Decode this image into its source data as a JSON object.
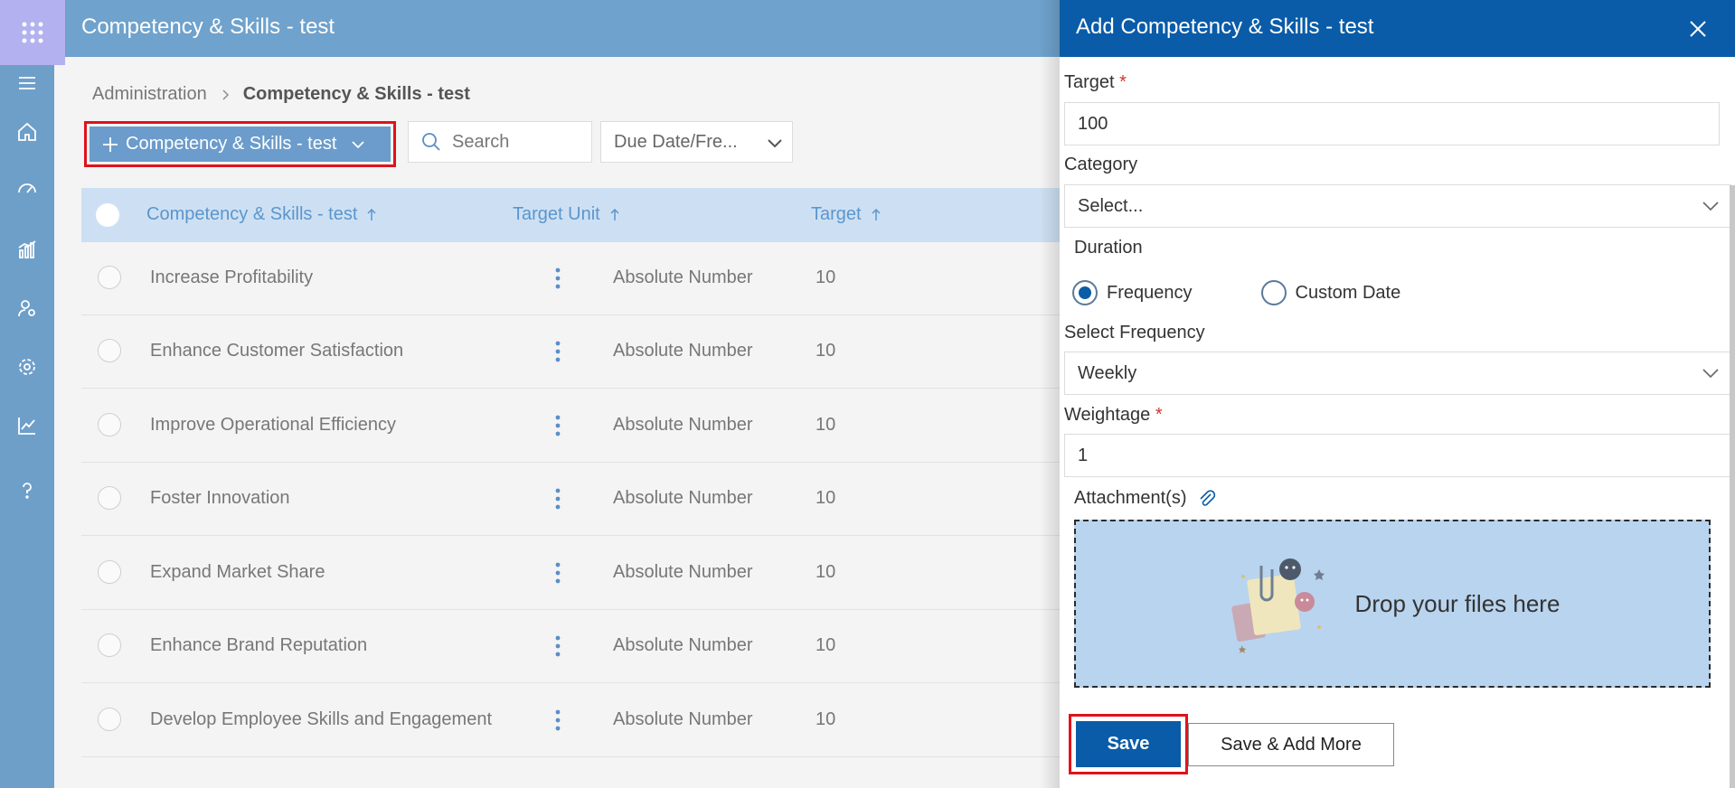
{
  "app": {
    "title": "Competency & Skills - test",
    "breadcrumb": [
      "Administration",
      "Competency & Skills - test"
    ]
  },
  "toolbar": {
    "add_label": "Competency & Skills - test",
    "search_placeholder": "Search",
    "due_filter": "Due Date/Fre..."
  },
  "table": {
    "columns": [
      "Competency & Skills - test",
      "Target Unit",
      "Target"
    ],
    "rows": [
      {
        "name": "Increase Profitability",
        "unit": "Absolute Number",
        "target": "10"
      },
      {
        "name": "Enhance Customer Satisfaction",
        "unit": "Absolute Number",
        "target": "10"
      },
      {
        "name": "Improve Operational Efficiency",
        "unit": "Absolute Number",
        "target": "10"
      },
      {
        "name": "Foster Innovation",
        "unit": "Absolute Number",
        "target": "10"
      },
      {
        "name": "Expand Market Share",
        "unit": "Absolute Number",
        "target": "10"
      },
      {
        "name": "Enhance Brand Reputation",
        "unit": "Absolute Number",
        "target": "10"
      },
      {
        "name": "Develop Employee Skills and Engagement",
        "unit": "Absolute Number",
        "target": "10"
      }
    ]
  },
  "panel": {
    "title": "Add Competency & Skills - test",
    "target_label": "Target",
    "target_value": "100",
    "category_label": "Category",
    "category_value": "Select...",
    "duration_label": "Duration",
    "duration_options": [
      "Frequency",
      "Custom Date"
    ],
    "frequency_label": "Select Frequency",
    "frequency_value": "Weekly",
    "weightage_label": "Weightage",
    "weightage_value": "1",
    "attachments_label": "Attachment(s)",
    "dropzone_text": "Drop your files here",
    "save_label": "Save",
    "save_more_label": "Save & Add More",
    "required_mark": "*"
  },
  "colors": {
    "rail": "#6e9fc9",
    "header": "#6fa2cc",
    "panel_header": "#0a5ca8",
    "highlight": "#e0121c",
    "table_header": "#cde0f3"
  }
}
